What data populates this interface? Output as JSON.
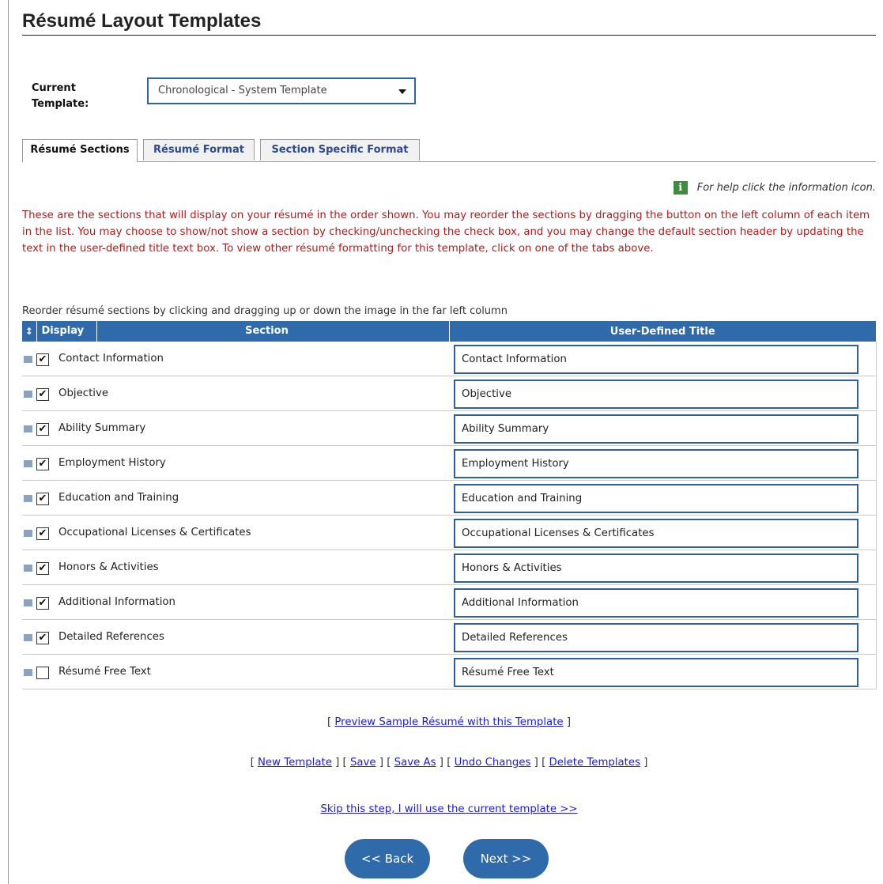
{
  "page": {
    "title": "Résumé Layout Templates"
  },
  "template": {
    "label": "Current Template:",
    "selected": "Chronological - System Template"
  },
  "tabs": [
    {
      "label": "Résumé Sections",
      "active": true
    },
    {
      "label": "Résumé Format",
      "active": false
    },
    {
      "label": "Section Specific Format",
      "active": false
    }
  ],
  "help": {
    "text": "For help click the information icon.",
    "icon": "i"
  },
  "intro": "These are the sections that will display on your résumé in the order shown. You may reorder the sections by dragging the button on the left column of each item in the list. You may choose to show/not show a section by checking/unchecking the check box, and you may change the default section header by updating the text in the user-defined title text box. To view other résumé formatting for this template, click on one of the tabs above.",
  "reorder_note": "Reorder résumé sections by clicking and dragging up or down the image in the far left column",
  "table": {
    "headers": {
      "display": "Display",
      "section": "Section",
      "user_title": "User-Defined Title"
    },
    "rows": [
      {
        "section": "Contact Information",
        "title": "Contact Information",
        "checked": true
      },
      {
        "section": "Objective",
        "title": "Objective",
        "checked": true
      },
      {
        "section": "Ability Summary",
        "title": "Ability Summary",
        "checked": true
      },
      {
        "section": "Employment History",
        "title": "Employment History",
        "checked": true
      },
      {
        "section": "Education and Training",
        "title": "Education and Training",
        "checked": true
      },
      {
        "section": "Occupational Licenses & Certificates",
        "title": "Occupational Licenses & Certificates",
        "checked": true
      },
      {
        "section": "Honors & Activities",
        "title": "Honors & Activities",
        "checked": true
      },
      {
        "section": "Additional Information",
        "title": "Additional Information",
        "checked": true
      },
      {
        "section": "Detailed References",
        "title": "Detailed References",
        "checked": true
      },
      {
        "section": "Résumé Free Text",
        "title": "Résumé Free Text",
        "checked": false
      }
    ]
  },
  "links": {
    "preview": "Preview Sample Résumé with this Template",
    "new_template": "New Template",
    "save": "Save",
    "save_as": "Save As",
    "undo": "Undo Changes",
    "delete": "Delete Templates",
    "skip": "Skip this step, I will use the current template >>"
  },
  "buttons": {
    "back": "<< Back",
    "next": "Next >>"
  },
  "colors": {
    "accent": "#2f6aaa",
    "intro_text": "#b21a1a",
    "link": "#1a1ae0",
    "info_icon": "#3d8c3f"
  }
}
